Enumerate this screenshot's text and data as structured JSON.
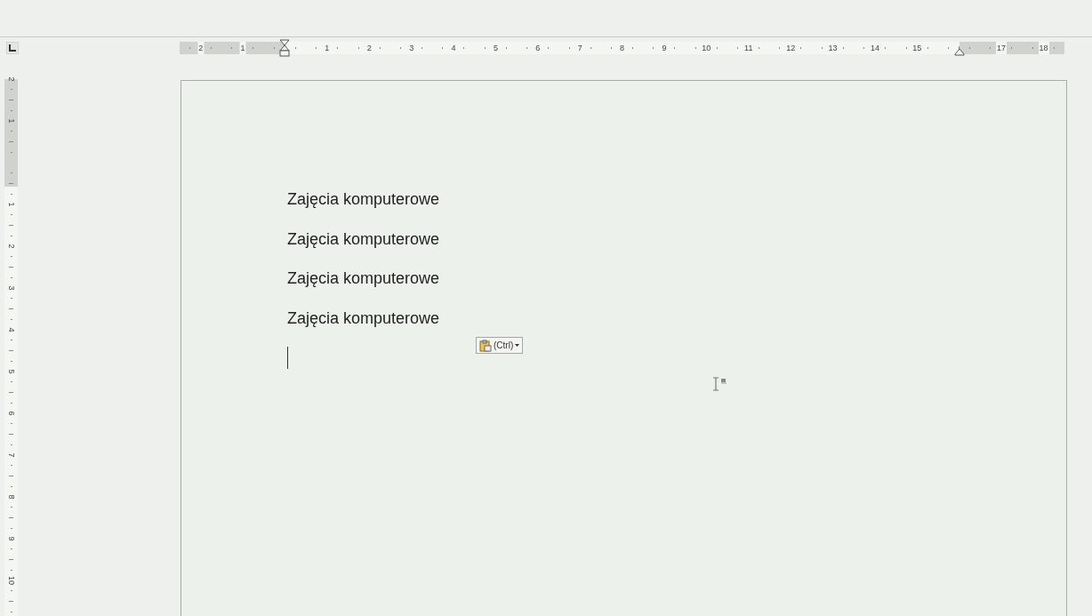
{
  "ruler": {
    "horizontal": [
      {
        "kind": "number",
        "label": "2"
      },
      {
        "kind": "number",
        "label": "1"
      },
      {
        "kind": "indent"
      },
      {
        "kind": "number",
        "label": "1"
      },
      {
        "kind": "number",
        "label": "2"
      },
      {
        "kind": "number",
        "label": "3"
      },
      {
        "kind": "number",
        "label": "4"
      },
      {
        "kind": "number",
        "label": "5"
      },
      {
        "kind": "number",
        "label": "6"
      },
      {
        "kind": "number",
        "label": "7"
      },
      {
        "kind": "number",
        "label": "8"
      },
      {
        "kind": "number",
        "label": "9"
      },
      {
        "kind": "number",
        "label": "10"
      },
      {
        "kind": "number",
        "label": "11"
      },
      {
        "kind": "number",
        "label": "12"
      },
      {
        "kind": "number",
        "label": "13"
      },
      {
        "kind": "number",
        "label": "14"
      },
      {
        "kind": "number",
        "label": "15"
      },
      {
        "kind": "right-indent"
      },
      {
        "kind": "number",
        "label": "17"
      },
      {
        "kind": "number",
        "label": "18"
      }
    ],
    "vertical": [
      {
        "kind": "number",
        "label": "2"
      },
      {
        "kind": "number",
        "label": "1"
      },
      {
        "kind": "margin"
      },
      {
        "kind": "number",
        "label": "1"
      },
      {
        "kind": "number",
        "label": "2"
      },
      {
        "kind": "number",
        "label": "3"
      },
      {
        "kind": "number",
        "label": "4"
      },
      {
        "kind": "number",
        "label": "5"
      },
      {
        "kind": "number",
        "label": "6"
      },
      {
        "kind": "number",
        "label": "7"
      },
      {
        "kind": "number",
        "label": "8"
      },
      {
        "kind": "number",
        "label": "9"
      },
      {
        "kind": "number",
        "label": "10"
      }
    ]
  },
  "document": {
    "paragraphs": [
      "Zajęcia komputerowe",
      "Zajęcia komputerowe",
      "Zajęcia komputerowe",
      "Zajęcia komputerowe"
    ]
  },
  "paste_options": {
    "label": "(Ctrl)"
  }
}
